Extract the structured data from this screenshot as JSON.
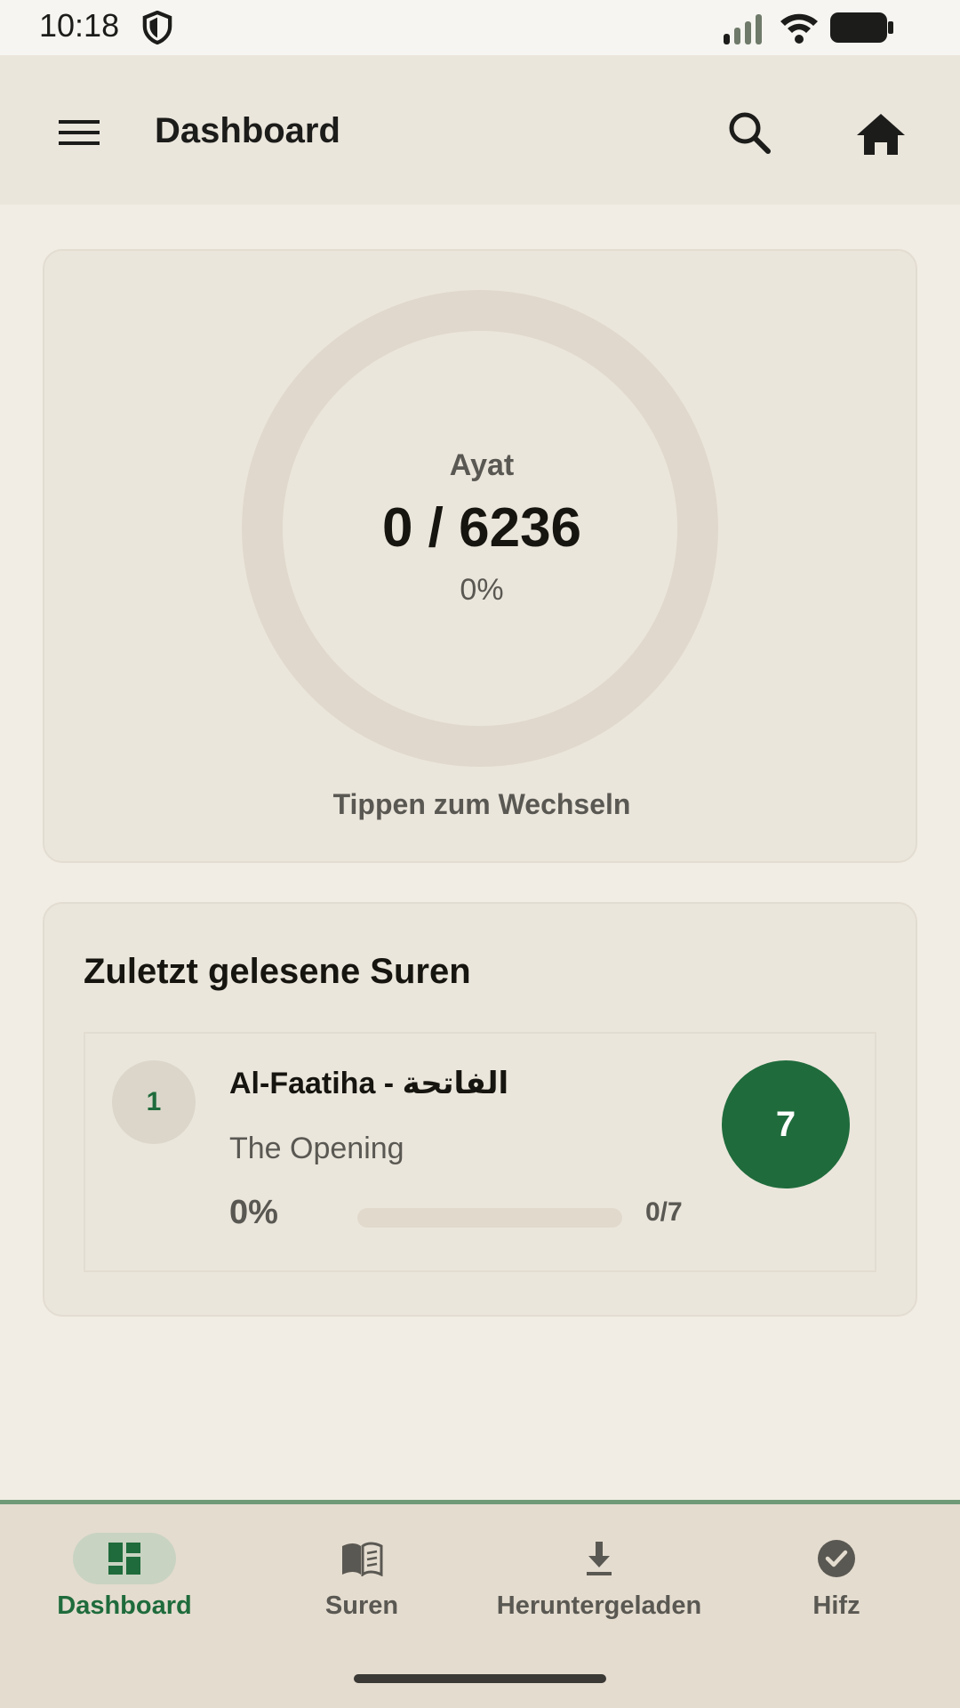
{
  "status_bar": {
    "time": "10:18",
    "icons": [
      "shield-icon",
      "signal-icon",
      "wifi-icon",
      "battery-icon"
    ]
  },
  "app_bar": {
    "title": "Dashboard",
    "icons": [
      "menu-icon",
      "search-icon",
      "home-icon"
    ]
  },
  "progress_card": {
    "label": "Ayat",
    "count": "0 / 6236",
    "percent": "0%",
    "hint": "Tippen zum Wechseln",
    "progress_fraction": 0
  },
  "recent": {
    "title": "Zuletzt gelesene Suren",
    "items": [
      {
        "number": "1",
        "name": "Al-Faatiha - الفاتحة",
        "subtitle": "The Opening",
        "percent": "0%",
        "fraction": "0/7",
        "progress_fraction": 0,
        "verses": "7"
      }
    ]
  },
  "bottom_nav": {
    "items": [
      {
        "label": "Dashboard",
        "icon": "dashboard-icon",
        "active": true
      },
      {
        "label": "Suren",
        "icon": "book-icon",
        "active": false
      },
      {
        "label": "Heruntergeladen",
        "icon": "download-icon",
        "active": false
      },
      {
        "label": "Hifz",
        "icon": "check-circle-icon",
        "active": false
      }
    ]
  },
  "colors": {
    "accent": "#1f6b3c",
    "background": "#f1ede4",
    "surface": "#ebe6dc",
    "nav_background": "#e4dccf"
  }
}
